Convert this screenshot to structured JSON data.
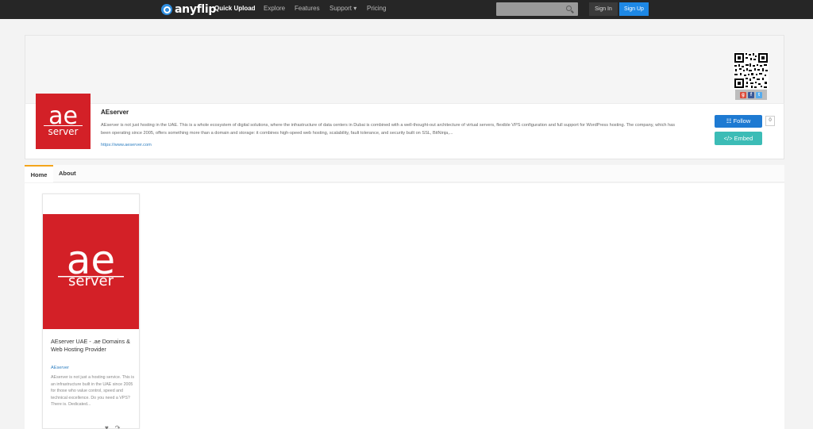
{
  "nav": {
    "logo": "anyflip",
    "items": [
      {
        "label": "Quick Upload",
        "active": true
      },
      {
        "label": "Explore",
        "active": false
      },
      {
        "label": "Features",
        "active": false
      },
      {
        "label": "Support ▾",
        "active": false
      },
      {
        "label": "Pricing",
        "active": false
      }
    ],
    "search_placeholder": "",
    "signin_label": "Sign In",
    "signup_label": "Sign Up"
  },
  "profile": {
    "name": "AEserver",
    "description": "AEserver is not just hosting in the UAE. This is a whole ecosystem of digital solutions, where the infrastructure of data centers in Dubai is combined with a well-thought-out architecture of virtual servers, flexible VPS configuration and full support for WordPress hosting. The company, which has been operating since 2005, offers something more than a domain and storage: it combines high-speed web hosting, scalability, fault tolerance, and security built on SSL, BitNinja,...",
    "url": "https://www.aeserver.com",
    "avatar_text_top": "ae",
    "avatar_text_bottom": "server",
    "follow_label": "Follow",
    "follow_count": "0",
    "embed_label": "Embed",
    "share_icons": [
      "google-plus-icon",
      "facebook-icon",
      "twitter-icon"
    ]
  },
  "tabs": [
    {
      "label": "Home",
      "active": true
    },
    {
      "label": "About",
      "active": false
    }
  ],
  "books": [
    {
      "title": "AEserver UAE - .ae Domains & Web Hosting Provider",
      "author": "AEserver",
      "description": "AEserver is not just a hosting service. This is an infrastructure built in the UAE since 2005 for those who value control, speed and technical excellence. Do you need a VPS? There is. Dedicated...",
      "cover_top": "ae",
      "cover_bottom": "server"
    }
  ],
  "colors": {
    "brand_red": "#d32027",
    "follow_blue": "#1e7ad2",
    "embed_teal": "#3cbcb6",
    "tab_accent": "#f4a51c",
    "nav_bg": "#262626"
  }
}
